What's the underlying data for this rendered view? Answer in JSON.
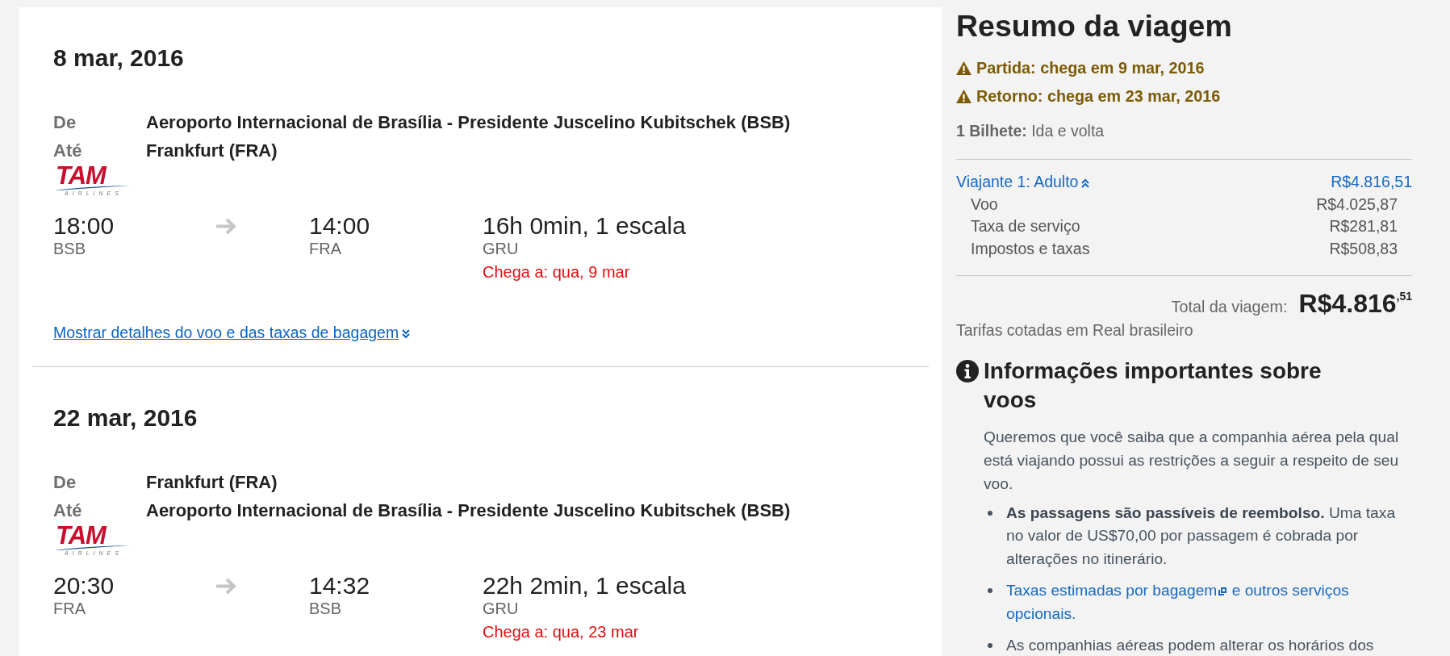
{
  "flights": [
    {
      "date": "8 mar, 2016",
      "route": [
        {
          "label": "De",
          "place": "Aeroporto Internacional de Brasília - Presidente Juscelino Kubitschek (BSB)"
        },
        {
          "label": "Até",
          "place": "Frankfurt (FRA)"
        }
      ],
      "airline_logo": {
        "name": "TAM",
        "tagline": "AIRLINES"
      },
      "departure": {
        "time": "18:00",
        "airport": "BSB"
      },
      "arrival": {
        "time": "14:00",
        "airport": "FRA"
      },
      "duration": "16h 0min, 1 escala",
      "stop": "GRU",
      "arrival_note": "Chega a: qua, 9 mar",
      "details_link": "Mostrar detalhes do voo e das taxas de bagagem"
    },
    {
      "date": "22 mar, 2016",
      "route": [
        {
          "label": "De",
          "place": "Frankfurt (FRA)"
        },
        {
          "label": "Até",
          "place": "Aeroporto Internacional de Brasília - Presidente Juscelino Kubitschek (BSB)"
        }
      ],
      "airline_logo": {
        "name": "TAM",
        "tagline": "AIRLINES"
      },
      "departure": {
        "time": "20:30",
        "airport": "FRA"
      },
      "arrival": {
        "time": "14:32",
        "airport": "BSB"
      },
      "duration": "22h 2min, 1 escala",
      "stop": "GRU",
      "arrival_note": "Chega a: qua, 23 mar"
    }
  ],
  "summary": {
    "title": "Resumo da viagem",
    "alerts": [
      "Partida: chega em 9 mar, 2016",
      "Retorno: chega em 23 mar, 2016"
    ],
    "ticket": "**1 Bilhete:** Ida e volta",
    "traveler": {
      "label": "Viajante 1: Adulto",
      "amount": "R$4.816,51",
      "expanded": true,
      "items": [
        {
          "label": "Voo",
          "amount": "R$4.025,87"
        },
        {
          "label": "Taxa de serviço",
          "amount": "R$281,81"
        },
        {
          "label": "Impostos e taxas",
          "amount": "R$508,83"
        }
      ]
    },
    "total_label": "Total da viagem:",
    "total": "R$4.816$^{,51}$",
    "currency_note": "Tarifas cotadas em Real brasileiro"
  },
  "info": {
    "title": "Informações importantes sobre voos",
    "intro": "Queremos que você saiba que a companhia aérea pela qual está viajando possui as restrições a seguir a respeito de seu voo.",
    "bullets": [
      {
        "kind": "text",
        "text": "**As passagens são passíveis de reembolso.** Uma taxa no valor de US$70,00 por passagem é cobrada por alterações no itinerário."
      },
      {
        "kind": "link",
        "text": "Taxas estimadas por bagagem",
        "continuation": "e outros serviços opcionais."
      },
      {
        "kind": "text",
        "text": "As companhias aéreas podem alterar os horários dos"
      }
    ]
  }
}
